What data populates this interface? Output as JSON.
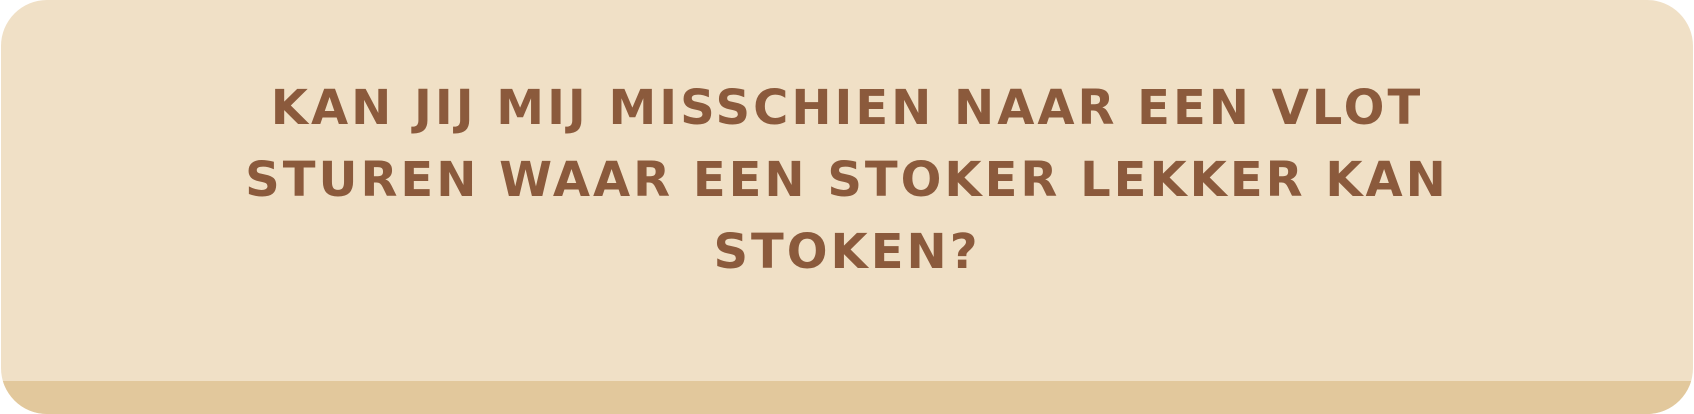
{
  "card": {
    "question": "Kan jij mij misschien naar een vlot sturen waar een stoker lekker kan stoken?",
    "colors": {
      "background": "#f0e0c6",
      "strip": "#e2c89c",
      "text": "#8b5a3c"
    }
  }
}
